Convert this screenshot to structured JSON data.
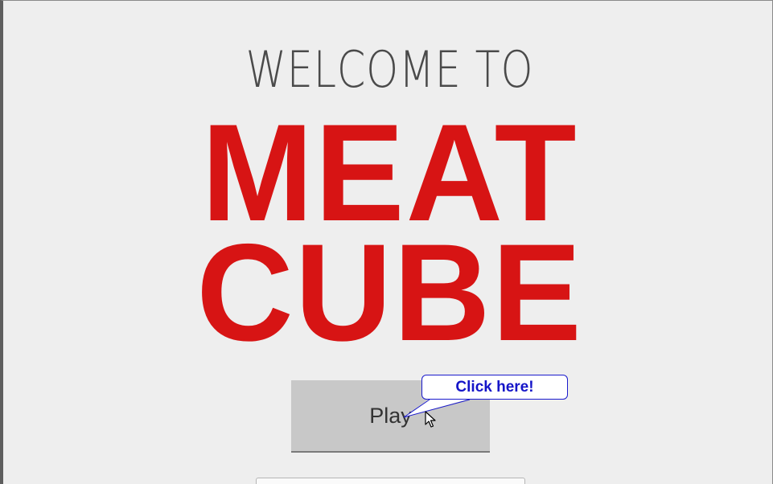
{
  "screen": {
    "welcome_text": "WELCOME TO",
    "title_line1": "MEAT",
    "title_line2": "CUBE",
    "play_label": "Play"
  },
  "tooltip": {
    "text": "Click here!"
  },
  "colors": {
    "background": "#eeeeee",
    "title_red": "#d71414",
    "button_gray": "#c8c8c8",
    "callout_blue": "#1515c8"
  },
  "icons": {
    "cursor": "arrow-pointer-icon"
  }
}
